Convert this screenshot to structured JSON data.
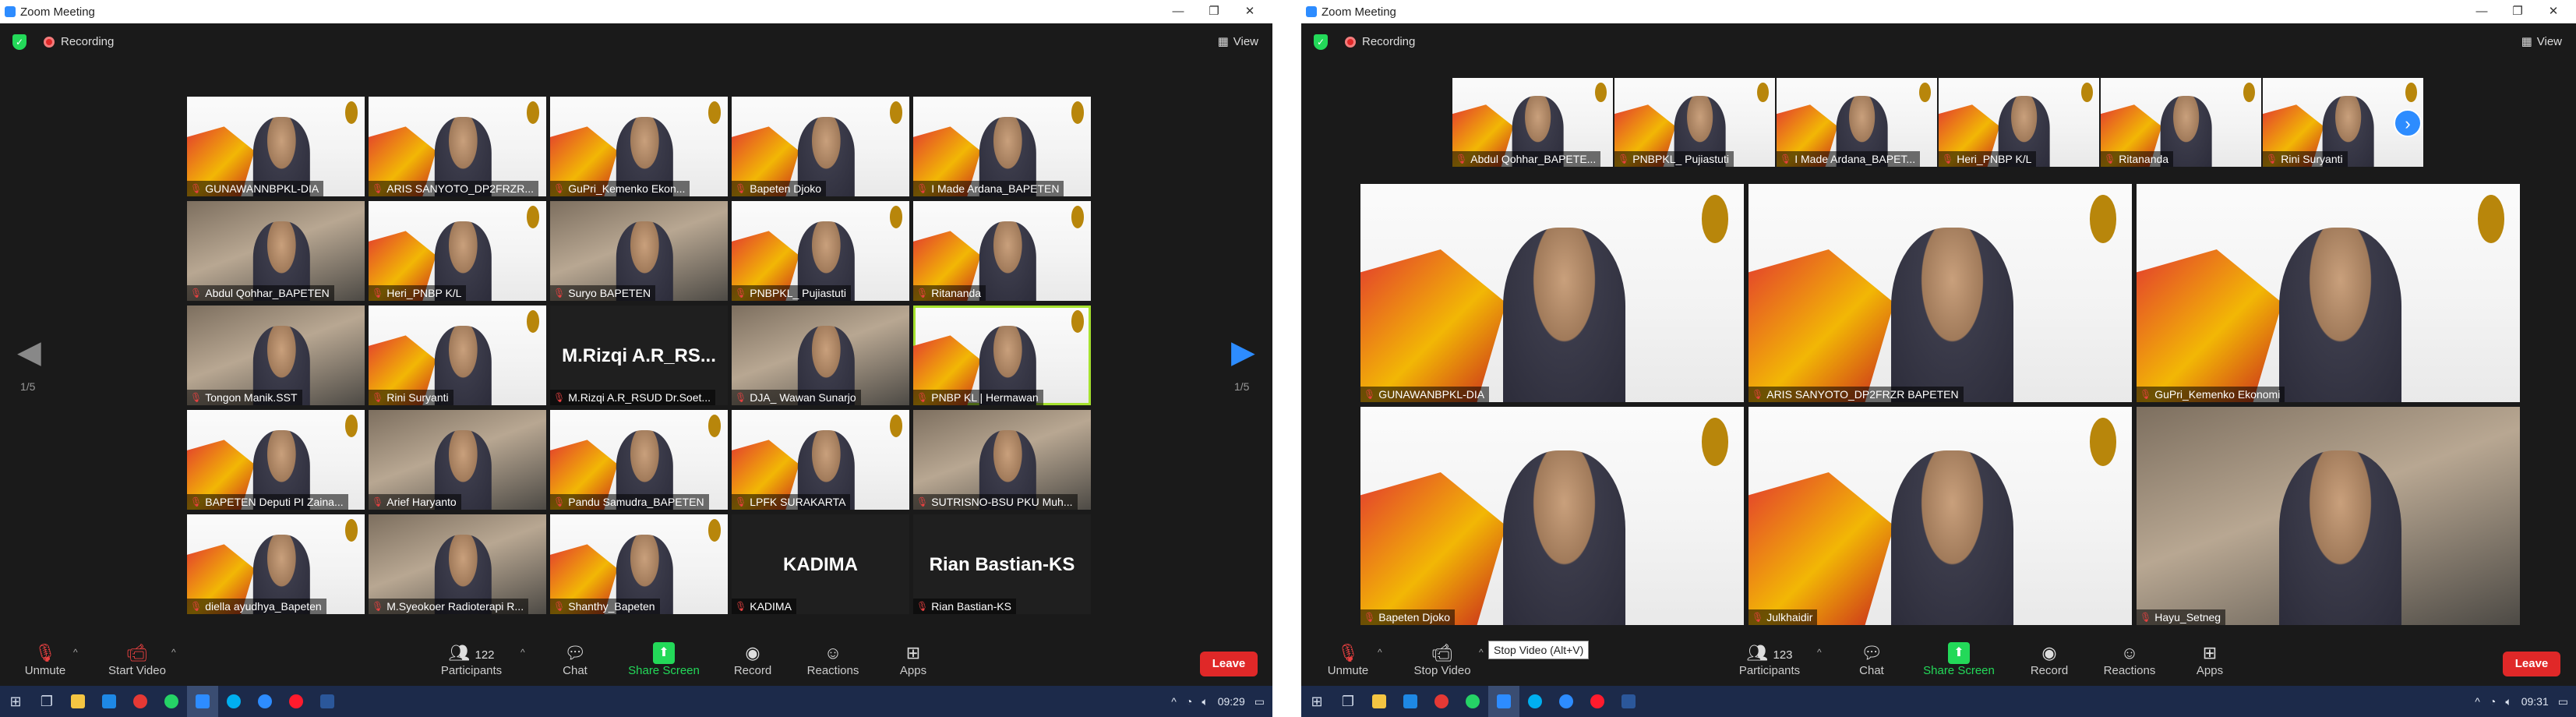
{
  "left": {
    "title": "Zoom Meeting",
    "recording": "Recording",
    "view": "View",
    "page_left": "1/5",
    "page_right": "1/5",
    "tiles": [
      {
        "name": "GUNAWANNBPKL-DIA",
        "kind": "video"
      },
      {
        "name": "ARIS SANYOTO_DP2FRZR...",
        "kind": "video"
      },
      {
        "name": "GuPri_Kemenko Ekon...",
        "kind": "video"
      },
      {
        "name": "Bapeten Djoko",
        "kind": "video"
      },
      {
        "name": "I Made Ardana_BAPETEN",
        "kind": "video"
      },
      {
        "name": "Abdul Qohhar_BAPETEN",
        "kind": "cam"
      },
      {
        "name": "Heri_PNBP K/L",
        "kind": "video"
      },
      {
        "name": "Suryo BAPETEN",
        "kind": "cam"
      },
      {
        "name": "PNBPKL_ Pujiastuti",
        "kind": "video"
      },
      {
        "name": "Ritananda",
        "kind": "video"
      },
      {
        "name": "Tongon Manik.SST",
        "kind": "cam"
      },
      {
        "name": "Rini Suryanti",
        "kind": "video"
      },
      {
        "name": "M.Rizqi A.R_RSUD Dr.Soet...",
        "kind": "name",
        "big": "M.Rizqi  A.R_RS..."
      },
      {
        "name": "DJA_ Wawan Sunarjo",
        "kind": "cam"
      },
      {
        "name": "PNBP KL | Hermawan",
        "kind": "video",
        "active": true
      },
      {
        "name": "BAPETEN Deputi PI Zaina...",
        "kind": "video"
      },
      {
        "name": "Arief Haryanto",
        "kind": "cam"
      },
      {
        "name": "Pandu Samudra_BAPETEN",
        "kind": "video"
      },
      {
        "name": "LPFK SURAKARTA",
        "kind": "video"
      },
      {
        "name": "SUTRISNO-BSU PKU Muh...",
        "kind": "cam"
      },
      {
        "name": "diella ayudhya_Bapeten",
        "kind": "video"
      },
      {
        "name": "M.Syeokoer Radioterapi R...",
        "kind": "cam"
      },
      {
        "name": "Shanthy_Bapeten",
        "kind": "video"
      },
      {
        "name": "KADIMA",
        "kind": "name",
        "big": "KADIMA"
      },
      {
        "name": "Rian Bastian-KS",
        "kind": "name",
        "big": "Rian Bastian-KS"
      }
    ],
    "toolbar": {
      "unmute": "Unmute",
      "start_video": "Start Video",
      "participants": "Participants",
      "participants_count": "122",
      "chat": "Chat",
      "share_screen": "Share Screen",
      "record": "Record",
      "reactions": "Reactions",
      "apps": "Apps",
      "leave": "Leave"
    },
    "clock": "09:29"
  },
  "right": {
    "title": "Zoom Meeting",
    "recording": "Recording",
    "view": "View",
    "strip": [
      {
        "name": "Abdul Qohhar_BAPETE..."
      },
      {
        "name": "PNBPKL_ Pujiastuti"
      },
      {
        "name": "I Made Ardana_BAPET..."
      },
      {
        "name": "Heri_PNBP K/L"
      },
      {
        "name": "Ritananda"
      },
      {
        "name": "Rini Suryanti"
      }
    ],
    "main": [
      {
        "name": "GUNAWANBPKL-DIA"
      },
      {
        "name": "ARIS SANYOTO_DP2FRZR BAPETEN"
      },
      {
        "name": "GuPri_Kemenko Ekonomi"
      },
      {
        "name": "Bapeten Djoko"
      },
      {
        "name": "Julkhaidir"
      },
      {
        "name": "Hayu_Setneg"
      }
    ],
    "toolbar": {
      "unmute": "Unmute",
      "stop_video": "Stop Video",
      "tooltip": "Stop Video (Alt+V)",
      "participants": "Participants",
      "participants_count": "123",
      "chat": "Chat",
      "share_screen": "Share Screen",
      "record": "Record",
      "reactions": "Reactions",
      "apps": "Apps",
      "leave": "Leave"
    },
    "clock": "09:31"
  },
  "colors": {
    "zoom_blue": "#2d8cff",
    "leave_red": "#e02828",
    "share_green": "#23d959",
    "active_speaker": "#a6e22e",
    "taskbar": "#1c2a4a"
  }
}
